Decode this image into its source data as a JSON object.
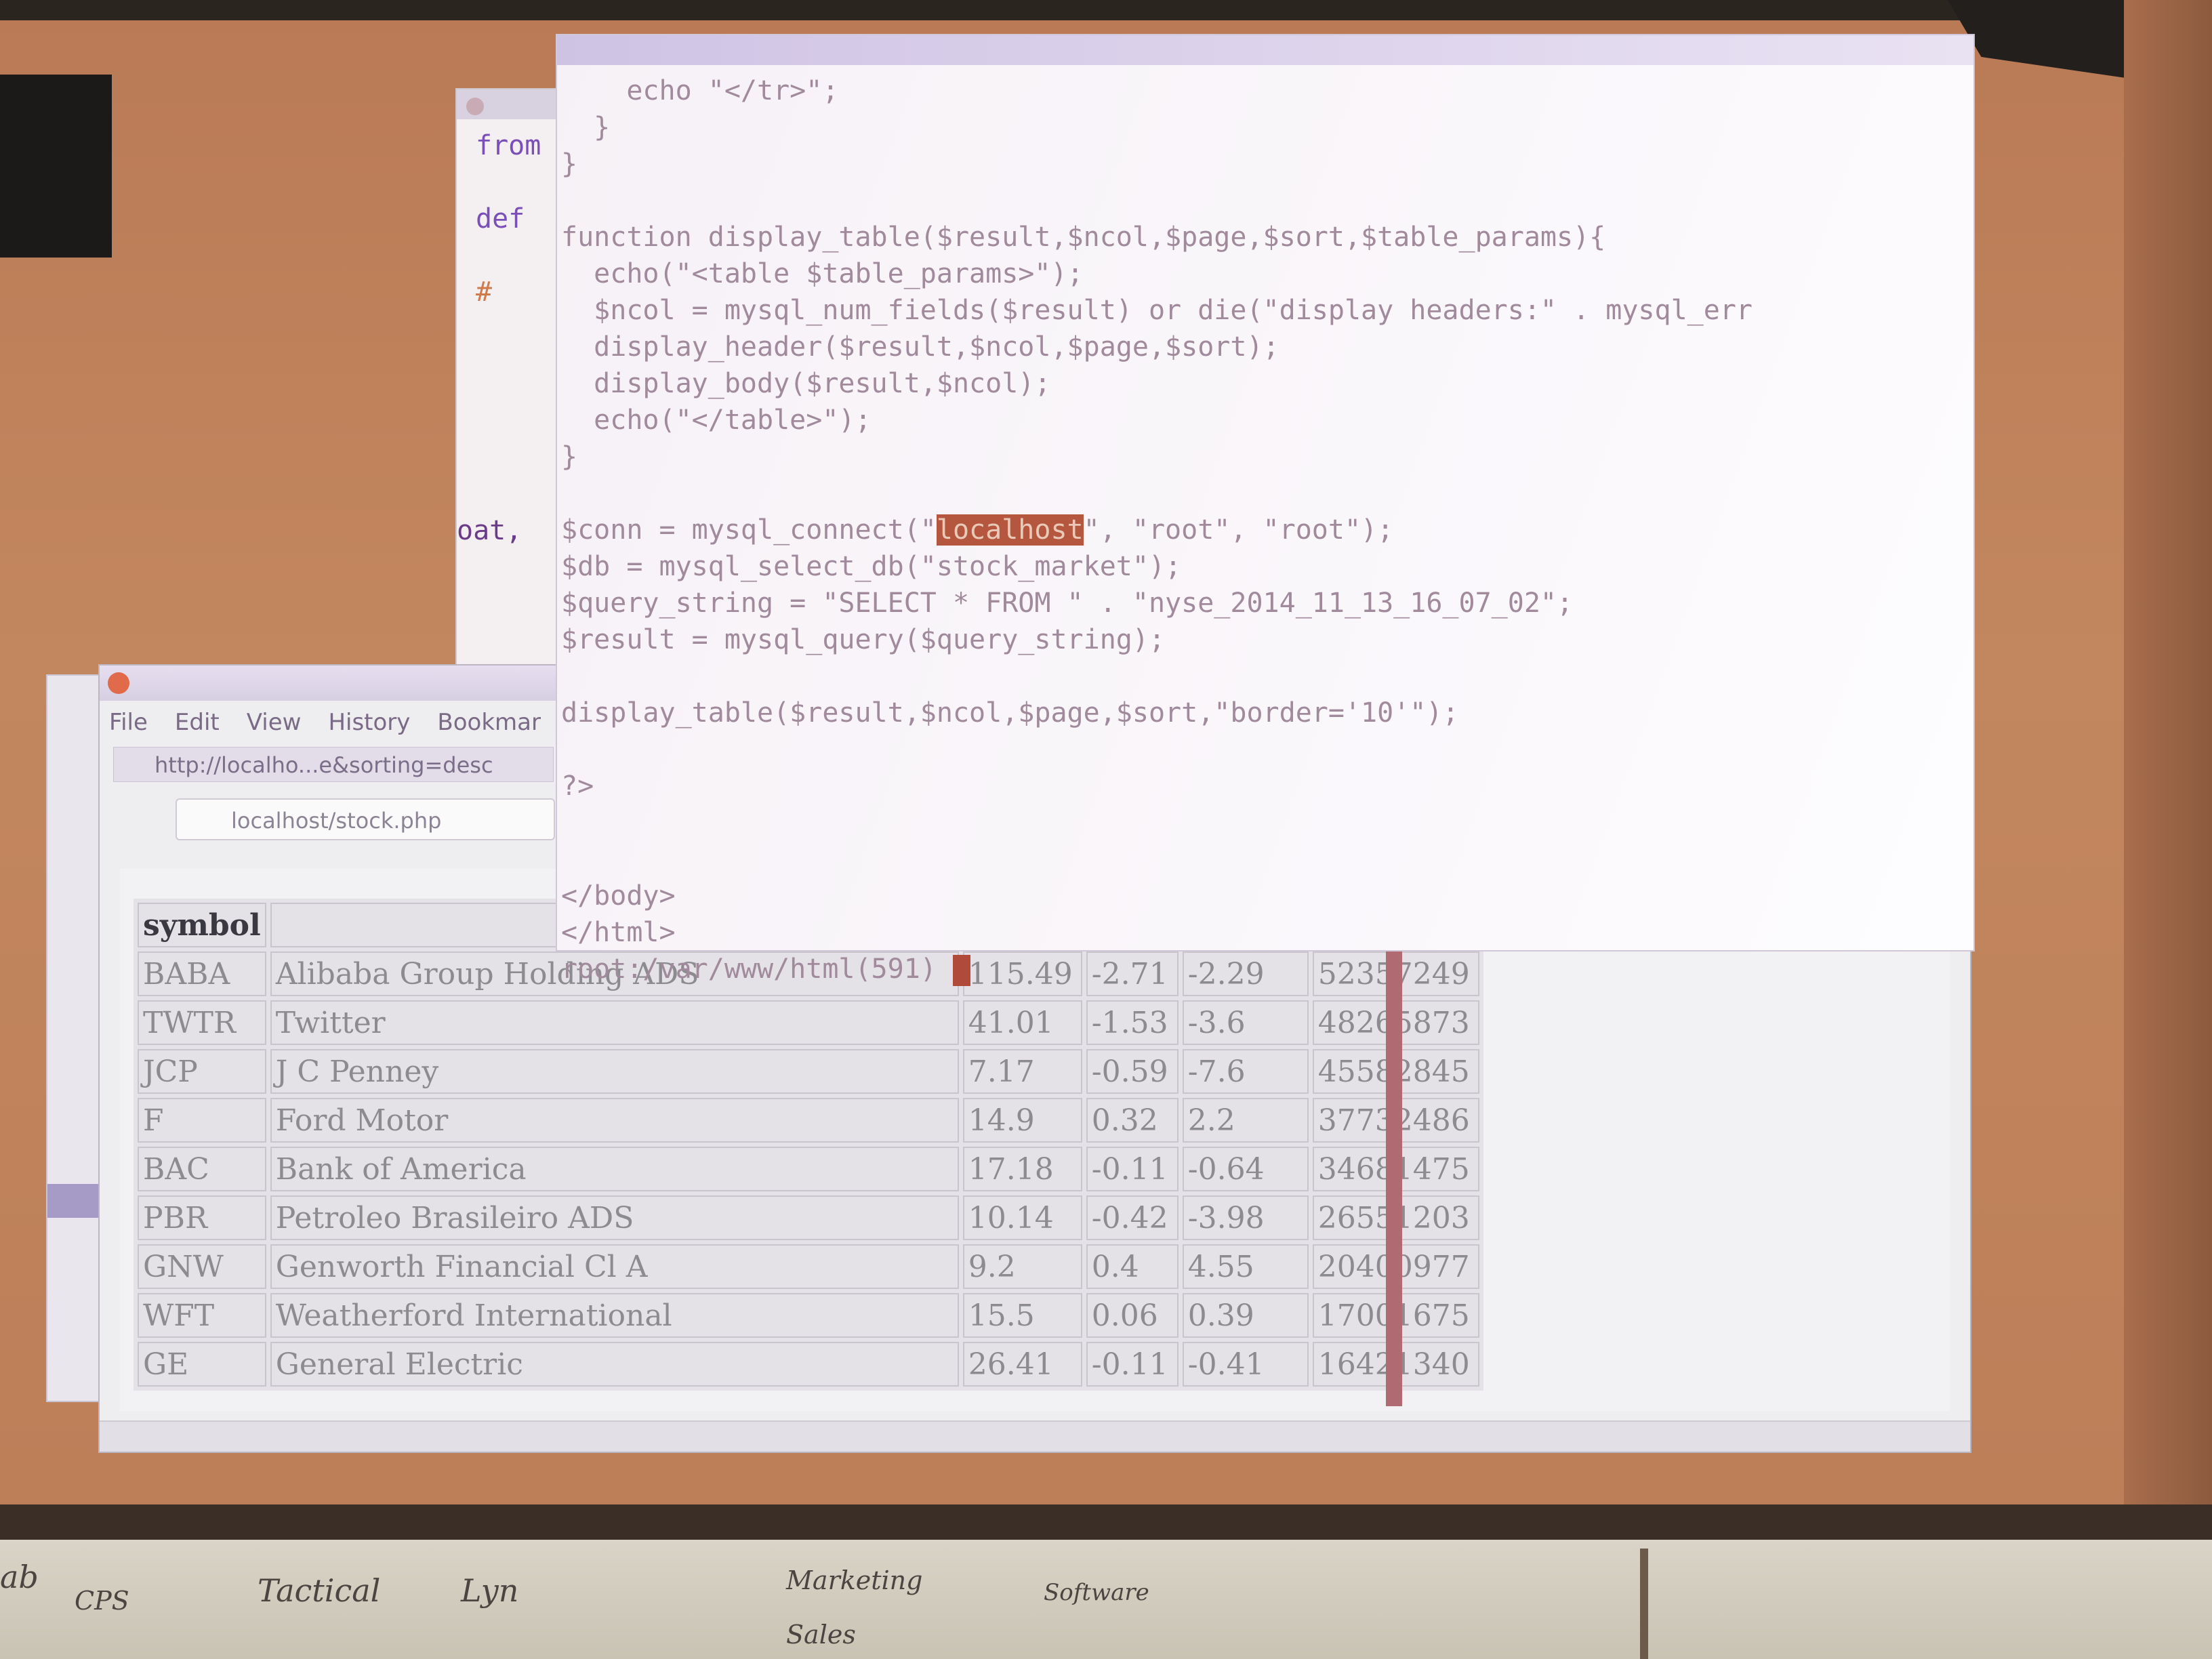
{
  "back_editor": {
    "snippets": [
      "from",
      "def",
      "#",
      "oat,"
    ]
  },
  "browser": {
    "menu": [
      "File",
      "Edit",
      "View",
      "History",
      "Bookmar"
    ],
    "tab_title": "http://localho...e&sorting=desc",
    "url": "localhost/stock.php",
    "table": {
      "headers": [
        "symbol",
        "",
        "",
        "",
        "",
        ""
      ],
      "rows": [
        [
          "BABA",
          "Alibaba Group Holding ADS",
          "115.49",
          "-2.71",
          "-2.29",
          "52357249"
        ],
        [
          "TWTR",
          "Twitter",
          "41.01",
          "-1.53",
          "-3.6",
          "48265873"
        ],
        [
          "JCP",
          "J C Penney",
          "7.17",
          "-0.59",
          "-7.6",
          "45582845"
        ],
        [
          "F",
          "Ford Motor",
          "14.9",
          "0.32",
          "2.2",
          "37732486"
        ],
        [
          "BAC",
          "Bank of America",
          "17.18",
          "-0.11",
          "-0.64",
          "34681475"
        ],
        [
          "PBR",
          "Petroleo Brasileiro ADS",
          "10.14",
          "-0.42",
          "-3.98",
          "26551203"
        ],
        [
          "GNW",
          "Genworth Financial Cl A",
          "9.2",
          "0.4",
          "4.55",
          "20400977"
        ],
        [
          "WFT",
          "Weatherford International",
          "15.5",
          "0.06",
          "0.39",
          "17001675"
        ],
        [
          "GE",
          "General Electric",
          "26.41",
          "-0.11",
          "-0.41",
          "16421340"
        ]
      ]
    }
  },
  "terminal": {
    "lines": [
      "    echo \"</tr>\";",
      "  }",
      "}",
      "",
      "function display_table($result,$ncol,$page,$sort,$table_params){",
      "  echo(\"<table $table_params>\");",
      "  $ncol = mysql_num_fields($result) or die(\"display headers:\" . mysql_err",
      "  display_header($result,$ncol,$page,$sort);",
      "  display_body($result,$ncol);",
      "  echo(\"</table>\");",
      "}",
      "",
      "$conn = mysql_connect(\"localhost\", \"root\", \"root\");",
      "$db = mysql_select_db(\"stock_market\");",
      "$query_string = \"SELECT * FROM \" . \"nyse_2014_11_13_16_07_02\";",
      "$result = mysql_query($query_string);",
      "",
      "display_table($result,$ncol,$page,$sort,\"border='10'\");",
      "",
      "?>",
      "",
      "",
      "</body>",
      "</html>",
      "root:/var/www/html(591) "
    ],
    "highlight": "localhost"
  },
  "whiteboard": {
    "scribbles": [
      "ab",
      "CPS",
      "Tactical",
      "Lyn",
      "Marketing",
      "Sales",
      "Software"
    ]
  }
}
